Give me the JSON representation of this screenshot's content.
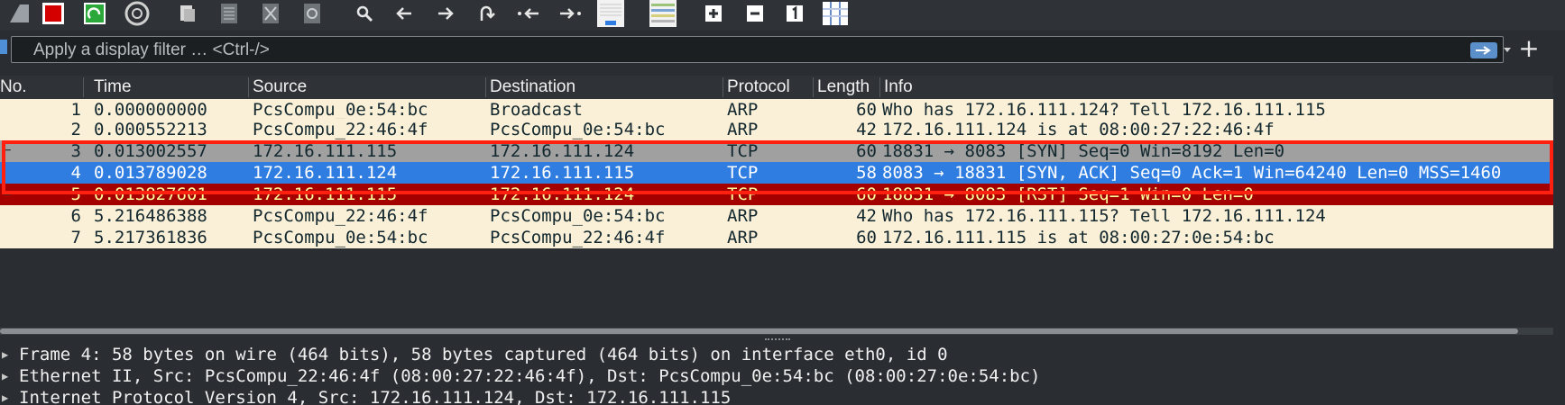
{
  "toolbar": {
    "buttons": [
      {
        "name": "shark-fin-icon",
        "label": "Start capture"
      },
      {
        "name": "stop-icon",
        "label": "Stop capture"
      },
      {
        "name": "restart-icon",
        "label": "Restart capture"
      },
      {
        "name": "gear-icon",
        "label": "Capture options"
      },
      {
        "name": "open-file-icon",
        "label": "Open"
      },
      {
        "name": "save-file-icon",
        "label": "Save"
      },
      {
        "name": "close-file-icon",
        "label": "Close"
      },
      {
        "name": "reload-icon",
        "label": "Reload"
      },
      {
        "name": "search-icon",
        "label": "Find packet"
      },
      {
        "name": "arrow-left-icon",
        "label": "Previous packet"
      },
      {
        "name": "arrow-right-icon",
        "label": "Next packet"
      },
      {
        "name": "go-to-packet-icon",
        "label": "Go to packet"
      },
      {
        "name": "first-packet-icon",
        "label": "First packet"
      },
      {
        "name": "last-packet-icon",
        "label": "Last packet"
      },
      {
        "name": "autoscroll-icon",
        "label": "Auto scroll"
      },
      {
        "name": "colorize-icon",
        "label": "Colorize"
      },
      {
        "name": "zoom-in-icon",
        "label": "Zoom in"
      },
      {
        "name": "zoom-out-icon",
        "label": "Zoom out"
      },
      {
        "name": "normal-size-icon",
        "label": "Normal size"
      },
      {
        "name": "resize-columns-icon",
        "label": "Resize columns"
      }
    ]
  },
  "filter": {
    "placeholder": "Apply a display filter … <Ctrl-/>",
    "add_label": "+"
  },
  "packet_list": {
    "columns": [
      "No.",
      "Time",
      "Source",
      "Destination",
      "Protocol",
      "Length",
      "Info"
    ],
    "rows": [
      {
        "no": "1",
        "time": "0.000000000",
        "source": "PcsCompu_0e:54:bc",
        "destination": "Broadcast",
        "protocol": "ARP",
        "length": "60",
        "info": "Who has 172.16.111.124? Tell 172.16.111.115",
        "style": "arp"
      },
      {
        "no": "2",
        "time": "0.000552213",
        "source": "PcsCompu_22:46:4f",
        "destination": "PcsCompu_0e:54:bc",
        "protocol": "ARP",
        "length": "42",
        "info": "172.16.111.124 is at 08:00:27:22:46:4f",
        "style": "arp"
      },
      {
        "no": "3",
        "time": "0.013002557",
        "source": "172.16.111.115",
        "destination": "172.16.111.124",
        "protocol": "TCP",
        "length": "60",
        "info": "18831 → 8083 [SYN] Seq=0 Win=8192 Len=0",
        "style": "syn"
      },
      {
        "no": "4",
        "time": "0.013789028",
        "source": "172.16.111.124",
        "destination": "172.16.111.115",
        "protocol": "TCP",
        "length": "58",
        "info": "8083 → 18831 [SYN, ACK] Seq=0 Ack=1 Win=64240 Len=0 MSS=1460",
        "style": "selected"
      },
      {
        "no": "5",
        "time": "0.013827601",
        "source": "172.16.111.115",
        "destination": "172.16.111.124",
        "protocol": "TCP",
        "length": "60",
        "info": "18831 → 8083 [RST] Seq=1 Win=0 Len=0",
        "style": "rst"
      },
      {
        "no": "6",
        "time": "5.216486388",
        "source": "PcsCompu_22:46:4f",
        "destination": "PcsCompu_0e:54:bc",
        "protocol": "ARP",
        "length": "42",
        "info": "Who has 172.16.111.115? Tell 172.16.111.124",
        "style": "arp"
      },
      {
        "no": "7",
        "time": "5.217361836",
        "source": "PcsCompu_0e:54:bc",
        "destination": "PcsCompu_22:46:4f",
        "protocol": "ARP",
        "length": "60",
        "info": "172.16.111.115 is at 08:00:27:0e:54:bc",
        "style": "arp"
      }
    ]
  },
  "details": {
    "lines": [
      "Frame 4: 58 bytes on wire (464 bits), 58 bytes captured (464 bits) on interface eth0, id 0",
      "Ethernet II, Src: PcsCompu_22:46:4f (08:00:27:22:46:4f), Dst: PcsCompu_0e:54:bc (08:00:27:0e:54:bc)",
      "Internet Protocol Version 4, Src: 172.16.111.124, Dst: 172.16.111.115"
    ]
  },
  "colors": {
    "arp_row": "#faf0d7",
    "syn_row": "#a0a0a0",
    "selected_row": "#2f7de1",
    "rst_row": "#a40000",
    "highlight_box": "#ff2010"
  }
}
